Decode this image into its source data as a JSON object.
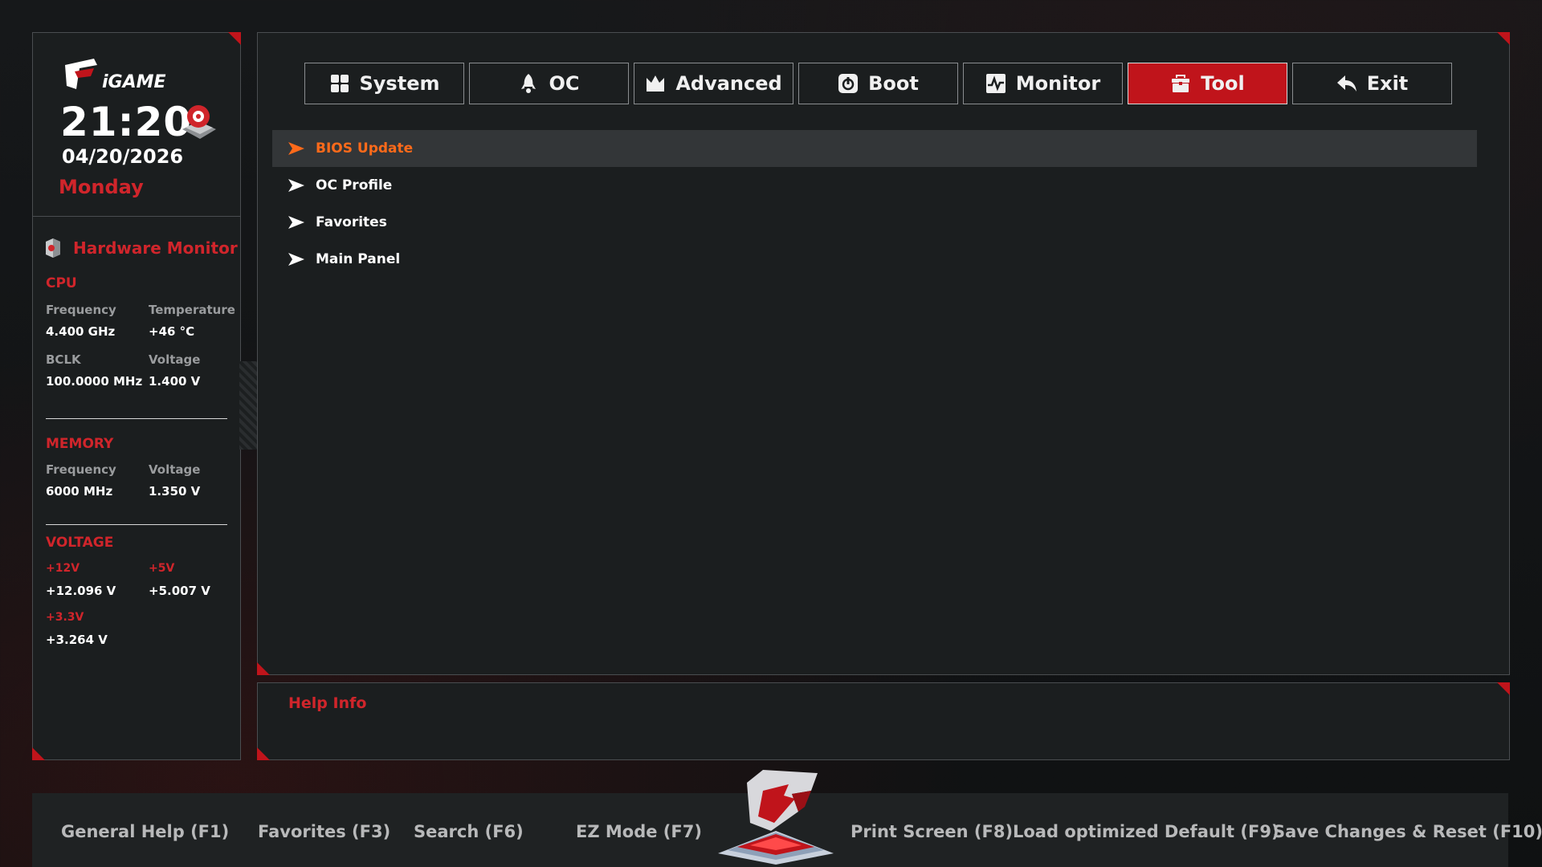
{
  "sidebar": {
    "brand": "iGAME",
    "time": "21:20",
    "date": "04/20/2026",
    "weekday": "Monday",
    "hardware_monitor_title": "Hardware Monitor",
    "cpu": {
      "title": "CPU",
      "frequency_label": "Frequency",
      "frequency_value": "4.400 GHz",
      "temperature_label": "Temperature",
      "temperature_value": "+46 °C",
      "bclk_label": "BCLK",
      "bclk_value": "100.0000 MHz",
      "voltage_label": "Voltage",
      "voltage_value": "1.400 V"
    },
    "memory": {
      "title": "MEMORY",
      "frequency_label": "Frequency",
      "frequency_value": "6000 MHz",
      "voltage_label": "Voltage",
      "voltage_value": "1.350 V"
    },
    "voltage": {
      "title": "VOLTAGE",
      "v12_label": "+12V",
      "v12_value": "+12.096 V",
      "v5_label": "+5V",
      "v5_value": "+5.007 V",
      "v33_label": "+3.3V",
      "v33_value": "+3.264 V"
    }
  },
  "tabs": [
    {
      "label": "System",
      "icon": "grid-icon"
    },
    {
      "label": "OC",
      "icon": "rocket-icon"
    },
    {
      "label": "Advanced",
      "icon": "crown-icon"
    },
    {
      "label": "Boot",
      "icon": "power-icon"
    },
    {
      "label": "Monitor",
      "icon": "pulse-icon"
    },
    {
      "label": "Tool",
      "icon": "toolbox-icon",
      "active": true
    },
    {
      "label": "Exit",
      "icon": "reply-icon"
    }
  ],
  "menu": [
    {
      "label": "BIOS Update",
      "selected": true
    },
    {
      "label": "OC Profile"
    },
    {
      "label": "Favorites"
    },
    {
      "label": "Main Panel"
    }
  ],
  "help": {
    "title": "Help Info"
  },
  "footer": {
    "general_help": "General Help (F1)",
    "favorites": "Favorites (F3)",
    "search": "Search (F6)",
    "ez_mode": "EZ Mode (F7)",
    "print_screen": "Print Screen (F8)",
    "load_default": "Load optimized Default (F9)",
    "save_reset": "Save Changes & Reset (F10)"
  },
  "colors": {
    "accent": "#c0141b",
    "selected_text": "#ff6a1a",
    "label_red": "#d0252b"
  }
}
